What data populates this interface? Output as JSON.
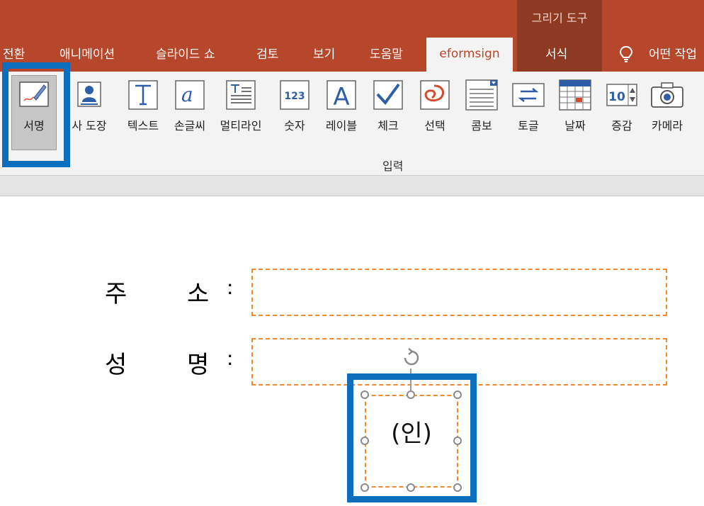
{
  "drawing_tools": {
    "title": "그리기 도구",
    "tab": "서식"
  },
  "tabs": [
    "전환",
    "애니메이션",
    "슬라이드 쇼",
    "검토",
    "보기",
    "도움말"
  ],
  "active_tab": "eformsign",
  "tell_me": "어떤 작업",
  "tools": [
    "서명",
    "사 도장",
    "텍스트",
    "손글씨",
    "멀티라인",
    "숫자",
    "레이블",
    "체크",
    "선택",
    "콤보",
    "토글",
    "날짜",
    "증감",
    "카메라"
  ],
  "tool_icons": {
    "number_text": "123",
    "label_text": "A",
    "spin_value": "10"
  },
  "group_label": "입력",
  "form": {
    "address_char1": "주",
    "address_char2": "소",
    "name_char1": "성",
    "name_char2": "명",
    "colon": ":",
    "seal_text": "(인)"
  },
  "colors": {
    "ribbon": "#b7472a",
    "highlight": "#0b6fbd",
    "dashed": "#f08a2c"
  }
}
